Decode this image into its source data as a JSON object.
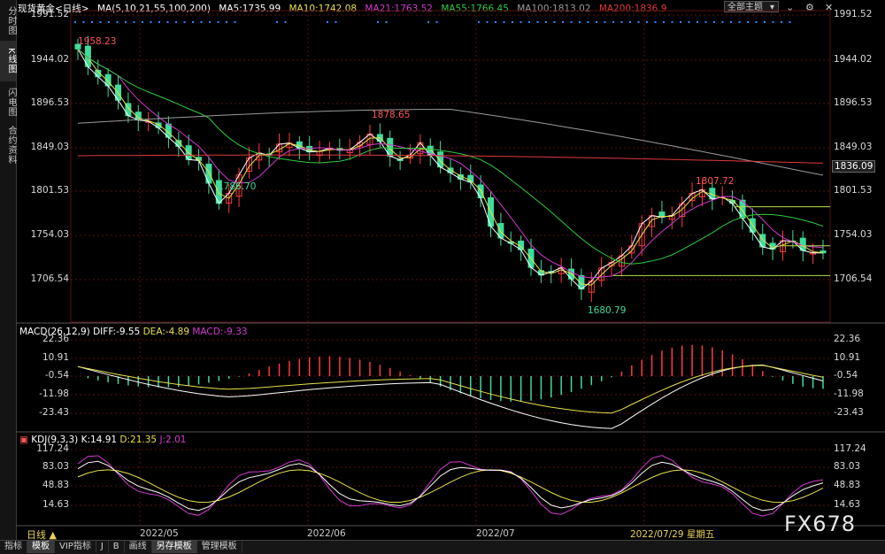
{
  "leftnav": [
    {
      "label": "分时图",
      "active": false
    },
    {
      "label": "K线图",
      "active": true
    },
    {
      "label": "闪电图",
      "active": false
    },
    {
      "label": "合约资料",
      "active": false
    }
  ],
  "header": {
    "symbol": "现货黄金<日线>",
    "ma_label": "MA(5,10,21,55,100,200)",
    "ma5": "MA5:1735.99",
    "ma10": "MA10:1742.08",
    "ma21": "MA21:1763.52",
    "ma55": "MA55:1766.45",
    "ma100": "MA100:1813.02",
    "ma200": "MA200:1836.9",
    "theme_select": "全部主题"
  },
  "price_axis": [
    "1991.52",
    "1944.02",
    "1896.53",
    "1849.03",
    "1801.53",
    "1754.03",
    "1706.54"
  ],
  "current_price": "1836.09",
  "annotations": {
    "high1": "1958.23",
    "high2": "1878.65",
    "low1": "1786.70",
    "high3": "1807.72",
    "low2": "1680.79"
  },
  "macd": {
    "title": "MACD(26,12,9)",
    "diff": "DIFF:-9.55",
    "dea": "DEA:-4.89",
    "macd": "MACD:-9.33",
    "axis": [
      "22.36",
      "10.91",
      "-0.54",
      "-11.98",
      "-23.43"
    ]
  },
  "kdj": {
    "title": "KDJ(9,3,3)",
    "k": "K:14.91",
    "d": "D:21.35",
    "j": "J:2.01",
    "axis": [
      "117.24",
      "83.03",
      "48.83",
      "14.63"
    ]
  },
  "x_axis": [
    "2022/05",
    "2022/06",
    "2022/07"
  ],
  "cursor_date": "2022/07/29 星期五",
  "period": "日线 ▲",
  "bottom_tabs": [
    {
      "label": "指标",
      "active": false
    },
    {
      "label": "模板",
      "active": true
    },
    {
      "label": "VIP指标",
      "active": false
    },
    {
      "label": "J",
      "active": false
    },
    {
      "label": "B",
      "active": false
    },
    {
      "label": "画线",
      "active": false
    },
    {
      "label": "另存模板",
      "active": true
    },
    {
      "label": "管理模板",
      "active": false
    }
  ],
  "watermark": "FX678",
  "colors": {
    "up": "#ff3b3b",
    "down": "#3fdc9b",
    "ma5": "#ffffff",
    "ma10": "#e6e04a",
    "ma21": "#d23ad2",
    "ma55": "#2ecc40",
    "ma100": "#9a9a9a",
    "ma200": "#e03a3a",
    "text_yellow": "#e8d25a"
  },
  "chart_data": {
    "type": "candlestick",
    "price_range": [
      1680.79,
      1991.52
    ],
    "annotated_points": {
      "high": 1958.23,
      "low": 1680.79,
      "mid_high": 1878.65,
      "mid_low": 1786.7,
      "late_high": 1807.72
    },
    "ma_values": {
      "MA5": 1735.99,
      "MA10": 1742.08,
      "MA21": 1763.52,
      "MA55": 1766.45,
      "MA100": 1813.02,
      "MA200": 1836.9
    }
  }
}
